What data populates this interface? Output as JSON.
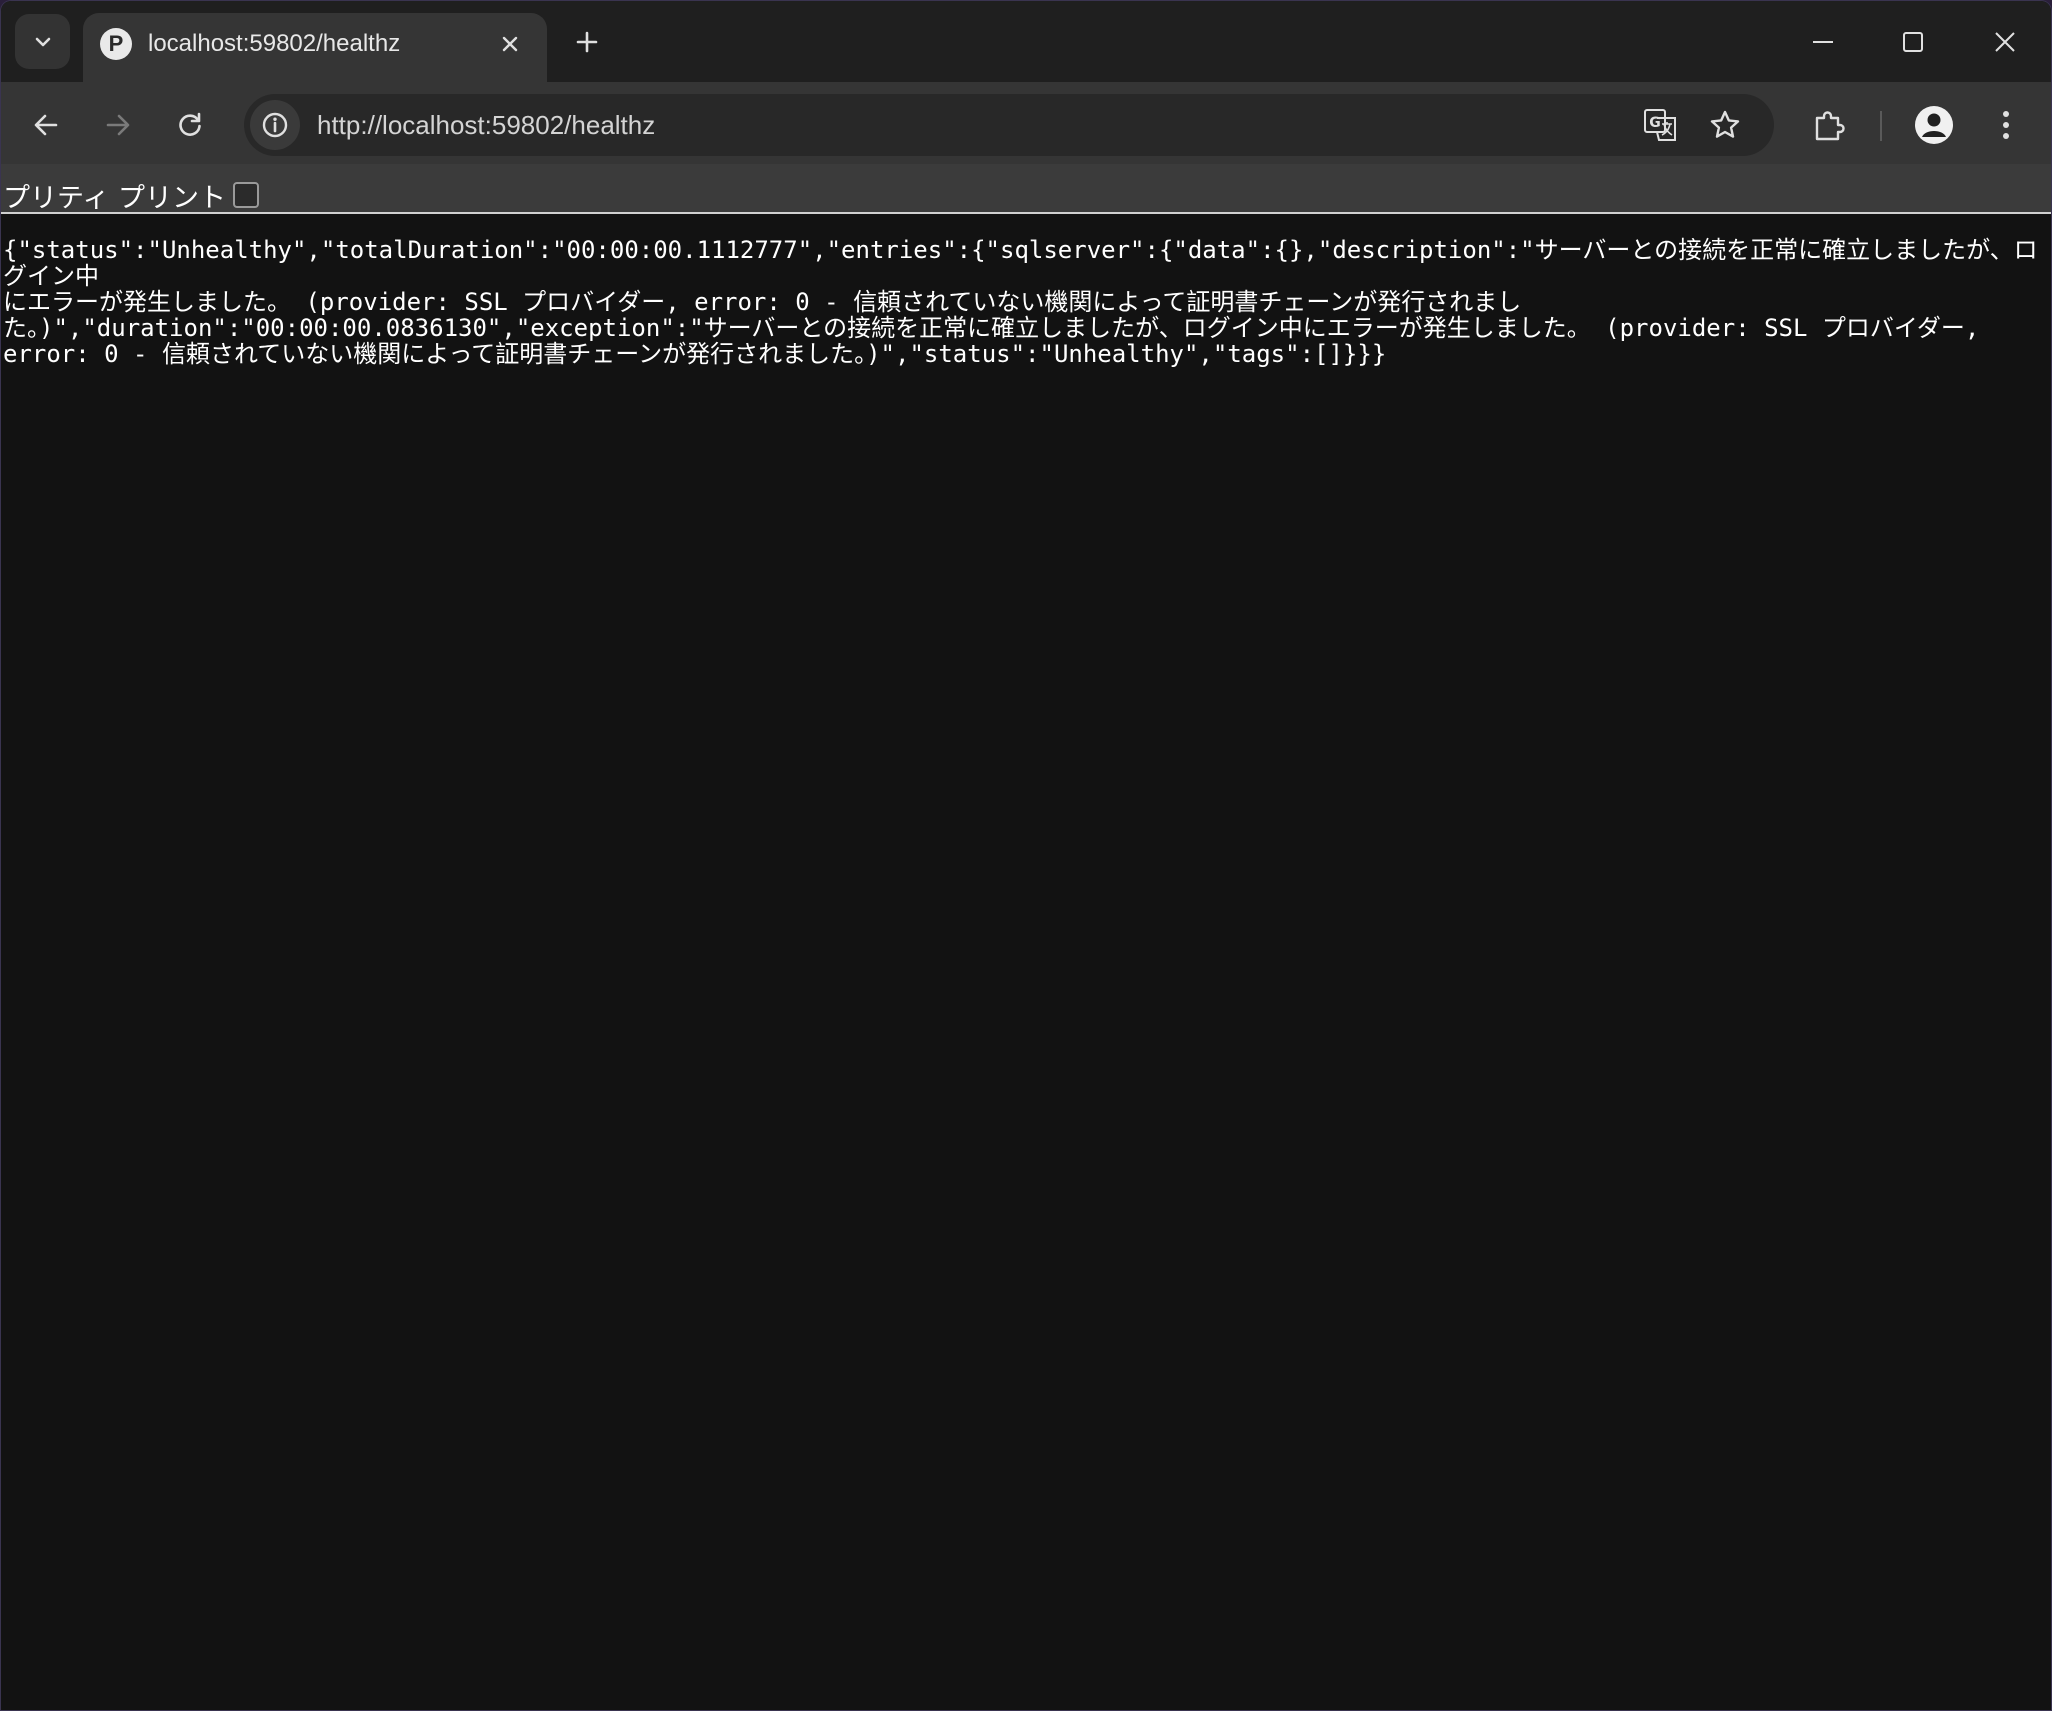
{
  "browser": {
    "tab_title": "localhost:59802/healthz",
    "tab_favicon_letter": "P",
    "url": "http://localhost:59802/healthz"
  },
  "prettyprint": {
    "label": "プリティ プリント",
    "checked": false
  },
  "body_text": {
    "line1": "{\"status\":\"Unhealthy\",\"totalDuration\":\"00:00:00.1112777\",\"entries\":{\"sqlserver\":{\"data\":{},\"description\":\"サーバーとの接続を正常に確立しましたが、ログイン中",
    "line2": "にエラーが発生しました。 (provider: SSL プロバイダー, error: 0 - 信頼されていない機関によって証明書チェーンが発行されまし",
    "line3": "た。)\",\"duration\":\"00:00:00.0836130\",\"exception\":\"サーバーとの接続を正常に確立しましたが、ログイン中にエラーが発生しました。 (provider: SSL プロバイダー,",
    "line4": "error: 0 - 信頼されていない機関によって証明書チェーンが発行されました。)\",\"status\":\"Unhealthy\",\"tags\":[]}}}"
  },
  "icons": {
    "tab_search": "chevron-down-icon",
    "close_tab": "close-icon",
    "new_tab": "plus-icon",
    "minimize": "minimize-icon",
    "maximize": "maximize-icon",
    "close_window": "close-icon",
    "back": "arrow-left-icon",
    "forward": "arrow-right-icon",
    "reload": "reload-icon",
    "site_info": "info-icon",
    "translate": "translate-icon",
    "bookmark": "star-icon",
    "extensions": "puzzle-icon",
    "profile": "profile-icon",
    "menu": "more-vert-icon"
  },
  "colors": {
    "tabstrip": "#1f1f1f",
    "toolbar": "#353535",
    "page_background": "#121212",
    "text": "#ffffff"
  }
}
